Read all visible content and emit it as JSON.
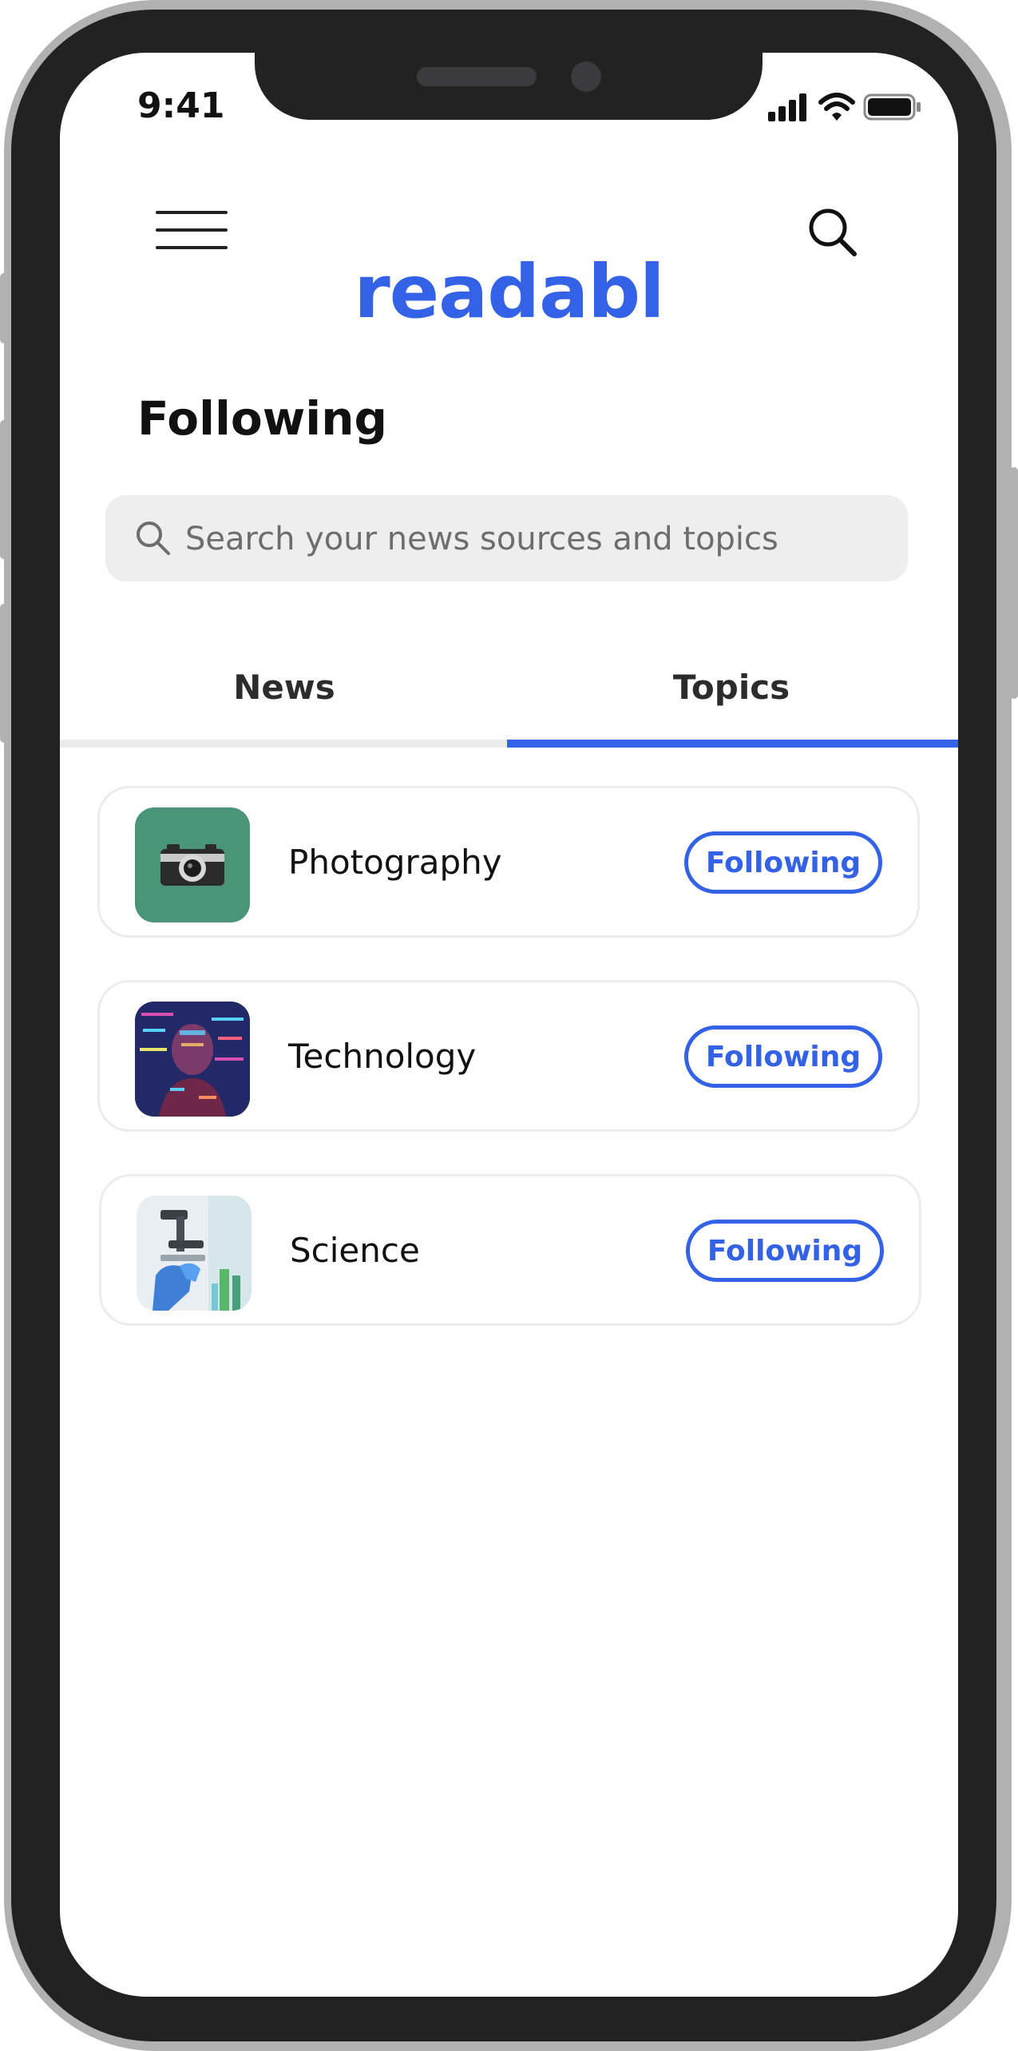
{
  "status_bar": {
    "time": "9:41"
  },
  "header": {
    "brand": "readabl",
    "page_title": "Following"
  },
  "search": {
    "placeholder": "Search your news sources and topics"
  },
  "tabs": [
    {
      "label": "News",
      "active": false
    },
    {
      "label": "Topics",
      "active": true
    }
  ],
  "topics": [
    {
      "name": "Photography",
      "button_label": "Following",
      "thumbnail": "camera-on-green"
    },
    {
      "name": "Technology",
      "button_label": "Following",
      "thumbnail": "person-with-code-projection"
    },
    {
      "name": "Science",
      "button_label": "Following",
      "thumbnail": "microscope-lab"
    }
  ],
  "icons": {
    "menu": "hamburger-menu-icon",
    "search": "search-icon",
    "signal": "signal-icon",
    "wifi": "wifi-icon",
    "battery": "battery-icon"
  },
  "colors": {
    "accent": "#3462e6",
    "tab_inactive_line": "#ececec",
    "search_bg": "#eeeeee"
  }
}
